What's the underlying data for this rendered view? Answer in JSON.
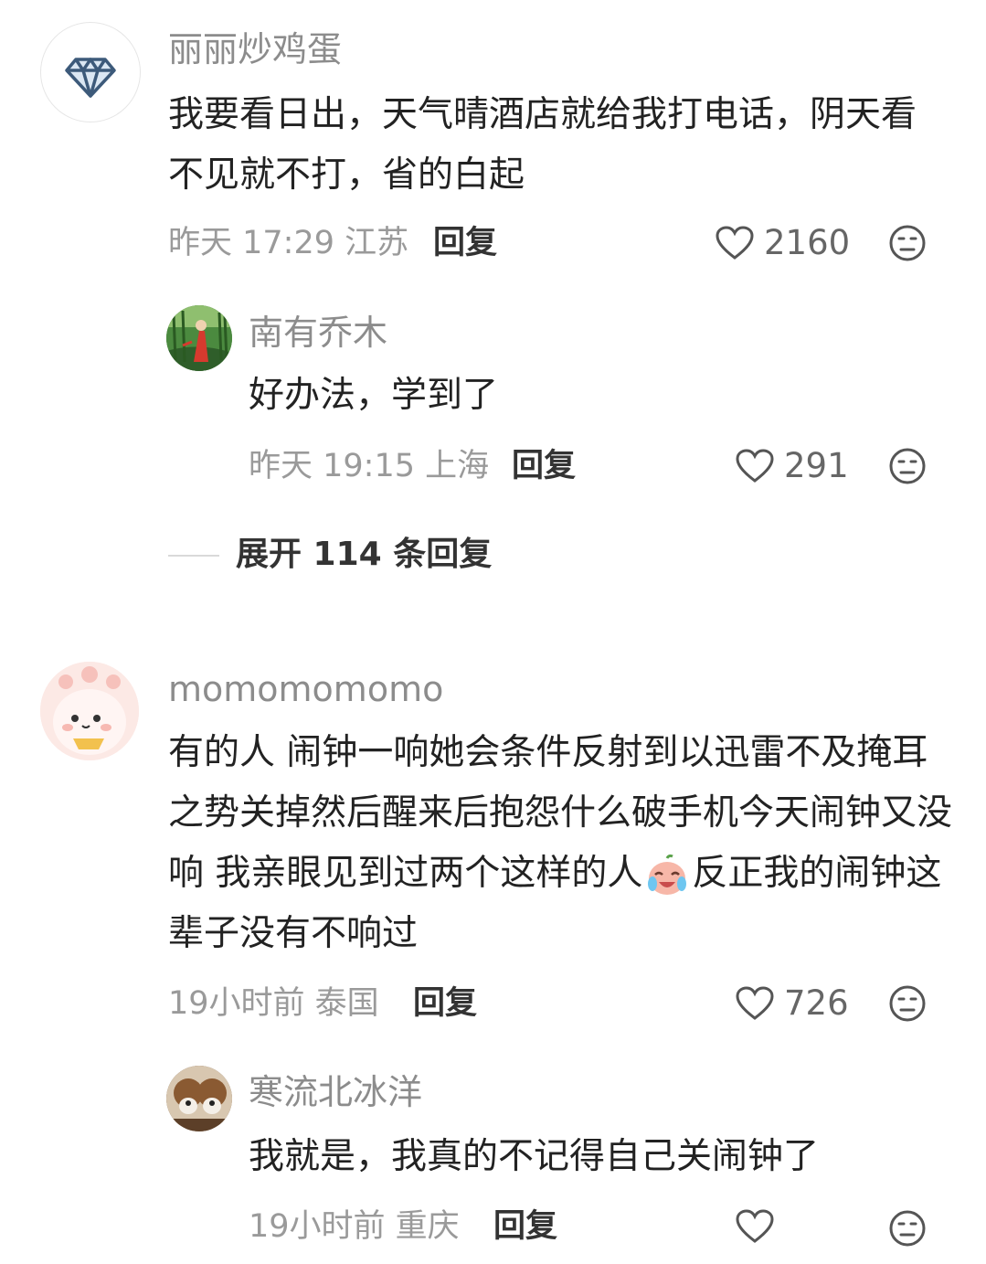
{
  "comments": [
    {
      "username": "丽丽炒鸡蛋",
      "text": "我要看日出，天气晴酒店就给我打电话，阴天看不见就不打，省的白起",
      "time": "昨天 17:29 江苏",
      "reply_label": "回复",
      "likes": "2160",
      "avatar_icon": "diamond-icon",
      "replies": [
        {
          "username": "南有乔木",
          "text": "好办法，学到了",
          "time": "昨天 19:15 上海",
          "reply_label": "回复",
          "likes": "291"
        }
      ],
      "expand_label": "展开 114 条回复"
    },
    {
      "username": "momomomomo",
      "text_before_emoji": "有的人 闹钟一响她会条件反射到以迅雷不及掩耳之势关掉然后醒来后抱怨什么破手机今天闹钟又没响 我亲眼见到过两个这样的人",
      "text_after_emoji": "反正我的闹钟这辈子没有不响过",
      "time": "19小时前 泰国",
      "reply_label": "回复",
      "likes": "726",
      "replies": [
        {
          "username": "寒流北冰洋",
          "text": "我就是，我真的不记得自己关闹钟了",
          "time": "19小时前 重庆",
          "reply_label": "回复"
        }
      ]
    }
  ],
  "colors": {
    "username": "#8c8c8c",
    "text": "#222222",
    "meta": "#9a9a9a",
    "diamond": "#3d5a7a"
  }
}
